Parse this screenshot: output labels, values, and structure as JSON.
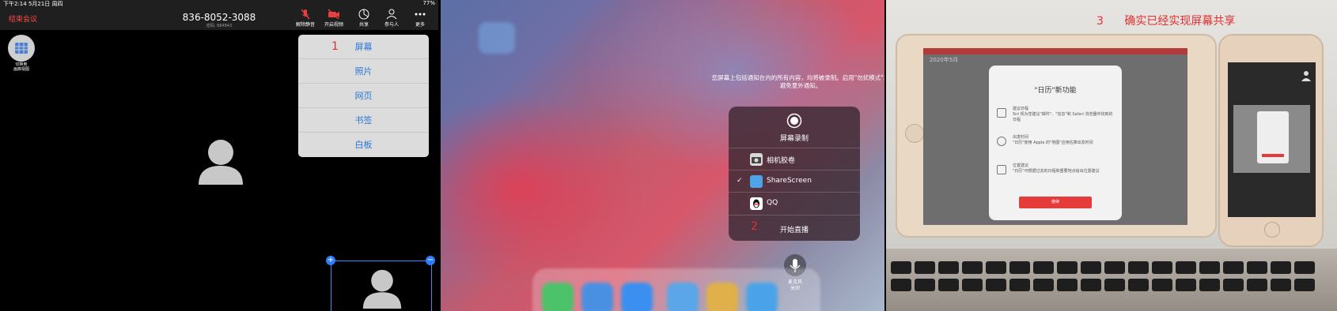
{
  "zoom": {
    "status_left": "下午2:14  5月21日 周四",
    "status_right": "77%",
    "end_meeting": "结束会议",
    "meeting_id": "836-8052-3088",
    "meeting_sub": "密码: 884843",
    "switch_camera_label": "切换到\n画廊视图",
    "toolbar": [
      {
        "label": "解除静音"
      },
      {
        "label": "开启视频"
      },
      {
        "label": "共享"
      },
      {
        "label": "参与人"
      },
      {
        "label": "更多"
      }
    ],
    "share_menu": [
      "屏幕",
      "照片",
      "网页",
      "书签",
      "白板"
    ],
    "step_number": "1",
    "thumb_plus": "+",
    "thumb_minus": "−"
  },
  "control_center": {
    "notice": "您屏幕上包括通知在内的所有内容，均将被录制。启用\"勿扰模式\"以避免意外通知。",
    "title": "屏幕录制",
    "options": [
      {
        "label": "相机胶卷",
        "checked": false
      },
      {
        "label": "ShareScreen",
        "checked": true
      },
      {
        "label": "QQ",
        "checked": false
      }
    ],
    "check_mark": "✓",
    "start_live": "开始直播",
    "step_number": "2",
    "mic_label": "麦克风\n关闭"
  },
  "photo": {
    "caption": "确实已经实现屏幕共享",
    "step_number": "3",
    "calendar_year": "2020年5月",
    "dialog_title": "\"日历\"新功能",
    "dialog_items": [
      "建议日程\nSiri 现为您建议\"邮件\"、\"信息\"和 Safari 浏览器中找到的日程",
      "出发时间\n\"日历\"使用 Apple 的\"地图\"应用估算出发时间",
      "位置建议\n\"日历\"可根据过去的日程和重要地点给出位置建议"
    ],
    "dialog_button": "继续"
  }
}
